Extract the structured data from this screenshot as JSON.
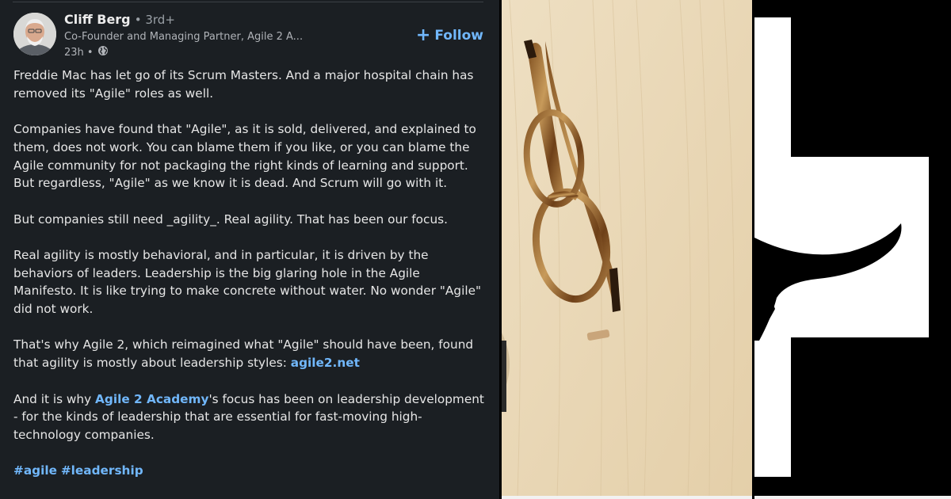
{
  "post": {
    "author_name": "Cliff Berg",
    "author_degree": "• 3rd+",
    "author_headline": "Co-Founder and Managing Partner, Agile 2 A...",
    "time_ago": "23h •",
    "follow_label": "Follow",
    "paragraph_1": "Freddie Mac has let go of its Scrum Masters. And a major hospital chain has removed its \"Agile\" roles as well.",
    "paragraph_2": "Companies have found that \"Agile\", as it is sold, delivered, and explained to them, does not work. You can blame them if you like, or you can blame the Agile community for not packaging the right kinds of learning and support. But regardless, \"Agile\" as we know it is dead. And Scrum will go with it.",
    "paragraph_3": "But companies still need _agility_. Real agility. That has been our focus.",
    "paragraph_4": "Real agility is mostly behavioral, and in particular, it is driven by the behaviors of leaders. Leadership is the big glaring hole in the Agile Manifesto. It is like trying to make concrete without water. No wonder \"Agile\" did not work.",
    "paragraph_5_text": "That's why Agile 2, which reimagined what \"Agile\" should have been, found that agility is mostly about leadership styles: ",
    "paragraph_5_link": "agile2.net",
    "paragraph_6_pre": "And it is why ",
    "paragraph_6_link": "Agile 2 Academy",
    "paragraph_6_post": "'s focus has been on leadership development - for the kinds of leadership that are essential for fast-moving high-technology companies.",
    "hashtag_1": "#agile",
    "hashtag_2": "#leadership"
  },
  "icons": {
    "globe": "globe-icon",
    "plus": "plus-icon"
  },
  "colors": {
    "post_background": "#1b1f23",
    "link_blue": "#71b7fb",
    "wood": "#e8d6b5",
    "logo_black": "#000000",
    "logo_white": "#ffffff"
  }
}
